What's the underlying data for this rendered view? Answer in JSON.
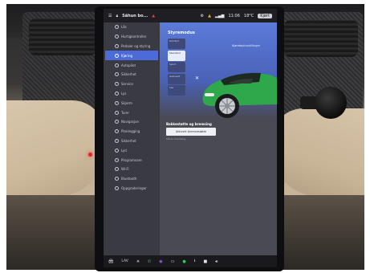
{
  "status_bar": {
    "user": "Sähun bo...",
    "time": "11:06",
    "temperature": "18°C",
    "pill": "Kjørt"
  },
  "menu": [
    {
      "label": "Lås",
      "active": false
    },
    {
      "label": "Hurtigkontroller",
      "active": false
    },
    {
      "label": "Pedaler og styring",
      "active": false
    },
    {
      "label": "Kjøring",
      "active": true
    },
    {
      "label": "Autopilot",
      "active": false
    },
    {
      "label": "Sikkerhet",
      "active": false
    },
    {
      "label": "Service",
      "active": false
    },
    {
      "label": "Lys",
      "active": false
    },
    {
      "label": "Skjerm",
      "active": false
    },
    {
      "label": "Turer",
      "active": false
    },
    {
      "label": "Navigasjon",
      "active": false
    },
    {
      "label": "Planlegging",
      "active": false
    },
    {
      "label": "Sikkerhet",
      "active": false
    },
    {
      "label": "Lyd",
      "active": false
    },
    {
      "label": "Programvare",
      "active": false
    },
    {
      "label": "Wi-Fi",
      "active": false
    },
    {
      "label": "Bluetooth",
      "active": false
    },
    {
      "label": "Oppgraderinger",
      "active": false
    }
  ],
  "content": {
    "section_title": "Styremodus",
    "car_link": "Kjøretøyinnstillinger",
    "options": [
      {
        "label": "Komfort",
        "selected": false
      },
      {
        "label": "Standard",
        "selected": true
      },
      {
        "label": "Sport",
        "selected": false
      },
      {
        "label": "Avansert",
        "selected": false
      },
      {
        "label": "Lav",
        "selected": false
      }
    ],
    "close": "✕",
    "feature_title": "Bakkestøtte og bremsing",
    "feature_button": "Aktivert bremsestøtte",
    "feature_note": "Slå av bremsing"
  },
  "dock": {
    "temp_label": "LAV",
    "icons": [
      "car-icon",
      "temp-icon",
      "phone-icon",
      "camera-icon",
      "apps-icon",
      "spotify-icon",
      "download-icon",
      "square-icon",
      "volume-icon"
    ]
  },
  "colors": {
    "accent": "#4c6bd8",
    "car_body": "#2ea84a"
  }
}
